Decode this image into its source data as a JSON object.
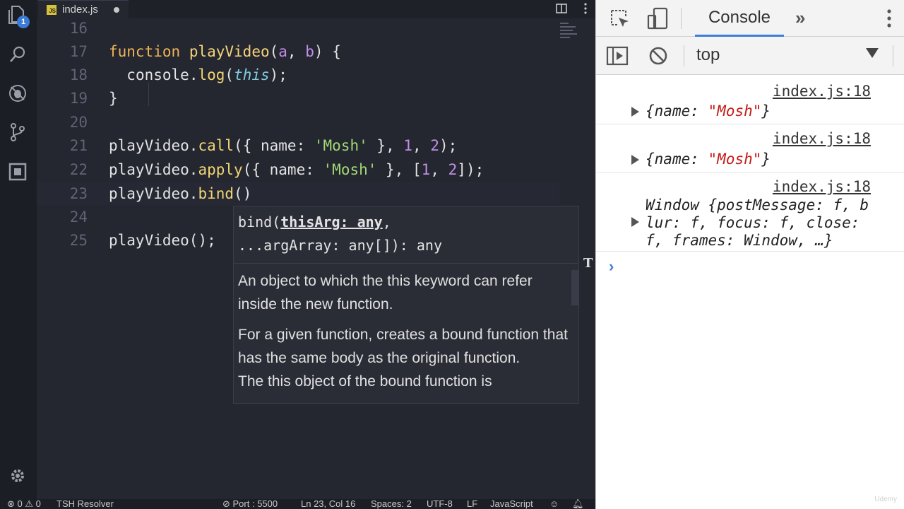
{
  "editor": {
    "tab": {
      "icon": "JS",
      "filename": "index.js"
    },
    "badge_count": "1",
    "code_lines": [
      {
        "num": "16",
        "text": ""
      },
      {
        "num": "17",
        "text": "function playVideo(a, b) {"
      },
      {
        "num": "18",
        "text": "  console.log(this);"
      },
      {
        "num": "19",
        "text": "}"
      },
      {
        "num": "20",
        "text": ""
      },
      {
        "num": "21",
        "text": "playVideo.call({ name: 'Mosh' }, 1, 2);"
      },
      {
        "num": "22",
        "text": "playVideo.apply({ name: 'Mosh' }, [1, 2]);"
      },
      {
        "num": "23",
        "text": "playVideo.bind()"
      },
      {
        "num": "24",
        "text": ""
      },
      {
        "num": "25",
        "text": "playVideo();"
      }
    ],
    "hover": {
      "sig_prefix": "bind(",
      "sig_param": "thisArg: any",
      "sig_after_param": ",",
      "sig_line2": "...argArray: any[]): any",
      "param_doc": "An object to which the this keyword can refer inside the new function.",
      "doc1": "For a given function, creates a bound function that has the same body as the original function.",
      "doc2": "The this object of the bound function is"
    },
    "status": {
      "errors": "0",
      "warnings": "0",
      "resolver": "TSH Resolver",
      "port": "Port : 5500",
      "position": "Ln 23, Col 16",
      "spaces": "Spaces: 2",
      "encoding": "UTF-8",
      "eol": "LF",
      "language": "JavaScript"
    }
  },
  "devtools": {
    "tab": "Console",
    "context": "top",
    "messages": [
      {
        "source": "index.js:18",
        "key": "name",
        "value": "\"Mosh\""
      },
      {
        "source": "index.js:18",
        "key": "name",
        "value": "\"Mosh\""
      },
      {
        "source": "index.js:18",
        "line1": "Window {postMessage: f, b",
        "line2": "lur: f, focus: f, close:",
        "line3": "f, frames: Window, …}"
      }
    ],
    "watermark": "Udemy"
  }
}
